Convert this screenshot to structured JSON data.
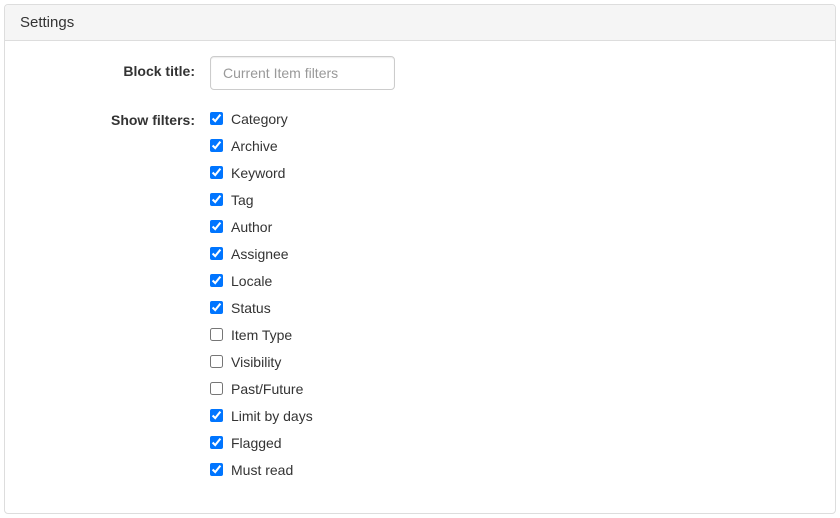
{
  "panel": {
    "title": "Settings"
  },
  "form": {
    "block_title_label": "Block title:",
    "block_title_placeholder": "Current Item filters",
    "block_title_value": "",
    "show_filters_label": "Show filters:"
  },
  "filters": [
    {
      "label": "Category",
      "checked": true
    },
    {
      "label": "Archive",
      "checked": true
    },
    {
      "label": "Keyword",
      "checked": true
    },
    {
      "label": "Tag",
      "checked": true
    },
    {
      "label": "Author",
      "checked": true
    },
    {
      "label": "Assignee",
      "checked": true
    },
    {
      "label": "Locale",
      "checked": true
    },
    {
      "label": "Status",
      "checked": true
    },
    {
      "label": "Item Type",
      "checked": false
    },
    {
      "label": "Visibility",
      "checked": false
    },
    {
      "label": "Past/Future",
      "checked": false
    },
    {
      "label": "Limit by days",
      "checked": true
    },
    {
      "label": "Flagged",
      "checked": true
    },
    {
      "label": "Must read",
      "checked": true
    }
  ]
}
